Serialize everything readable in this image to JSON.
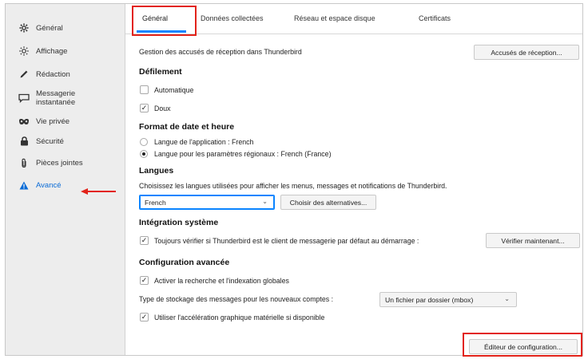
{
  "sidebar": {
    "items": [
      {
        "label": "Général",
        "icon": "gear-icon"
      },
      {
        "label": "Affichage",
        "icon": "sun-icon"
      },
      {
        "label": "Rédaction",
        "icon": "pen-icon"
      },
      {
        "label": "Messagerie\ninstantanée",
        "icon": "chat-icon"
      },
      {
        "label": "Vie privée",
        "icon": "mask-icon"
      },
      {
        "label": "Sécurité",
        "icon": "lock-icon"
      },
      {
        "label": "Pièces jointes",
        "icon": "paperclip-icon"
      },
      {
        "label": "Avancé",
        "icon": "warning-triangle-icon"
      }
    ],
    "active_color": "#0a6bd6"
  },
  "tabs": [
    "Général",
    "Données collectées",
    "Réseau et espace disque",
    "Certificats"
  ],
  "general": {
    "receipts_label": "Gestion des accusés de réception dans Thunderbird",
    "receipts_button": "Accusés de réception..."
  },
  "scrolling": {
    "heading": "Défilement",
    "auto_label": "Automatique",
    "auto_checked": false,
    "smooth_label": "Doux",
    "smooth_checked": true
  },
  "datetime": {
    "heading": "Format de date et heure",
    "option_app": "Langue de l'application : French",
    "option_regional": "Langue pour les paramètres régionaux : French (France)",
    "selected": "regional"
  },
  "languages": {
    "heading": "Langues",
    "description": "Choisissez les langues utilisées pour afficher les menus, messages et notifications de Thunderbird.",
    "selected": "French",
    "alternatives_button": "Choisir des alternatives..."
  },
  "integration": {
    "heading": "Intégration système",
    "default_check_label": "Toujours vérifier si Thunderbird est le client de messagerie par défaut au démarrage :",
    "default_check_checked": true,
    "check_now_button": "Vérifier maintenant..."
  },
  "advanced_config": {
    "heading": "Configuration avancée",
    "global_search_label": "Activer la recherche et l'indexation globales",
    "global_search_checked": true,
    "storage_label": "Type de stockage des messages pour les nouveaux comptes :",
    "storage_value": "Un fichier par dossier (mbox)",
    "hw_accel_label": "Utiliser l'accélération graphique matérielle si disponible",
    "hw_accel_checked": true,
    "config_editor_button": "Éditeur de configuration..."
  },
  "colors": {
    "highlight_red": "#e2231a",
    "accent_blue": "#0a84ff",
    "sidebar_bg": "#ededed"
  }
}
